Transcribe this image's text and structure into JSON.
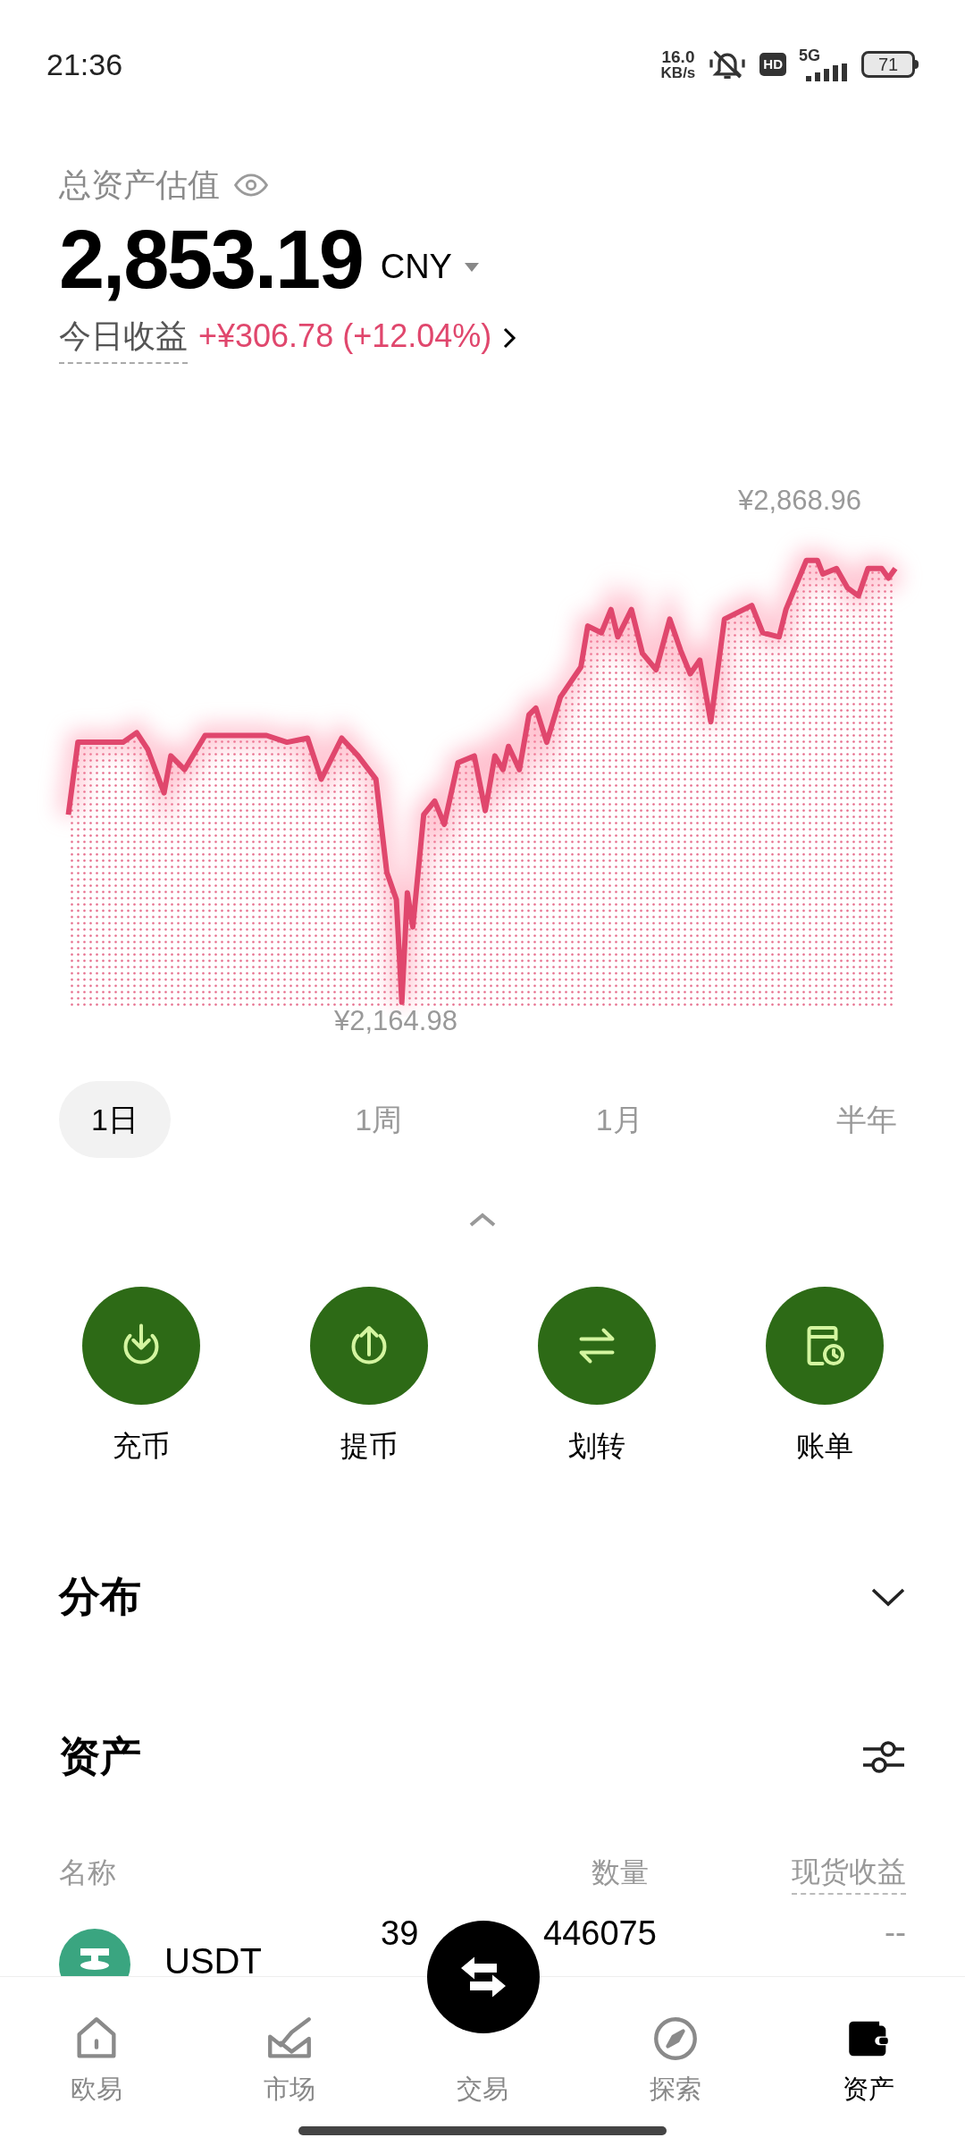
{
  "status_bar": {
    "time": "21:36",
    "speed_value": "16.0",
    "speed_unit": "KB/s",
    "hd": "HD",
    "network": "5G",
    "battery": "71"
  },
  "header": {
    "title": "总资产估值",
    "amount": "2,853.19",
    "currency": "CNY",
    "today_label": "今日收益",
    "today_value": "+¥306.78 (+12.04%)"
  },
  "chart": {
    "max_label": "¥2,868.96",
    "min_label": "¥2,164.98"
  },
  "periods": [
    {
      "label": "1日",
      "selected": true
    },
    {
      "label": "1周",
      "selected": false
    },
    {
      "label": "1月",
      "selected": false
    },
    {
      "label": "半年",
      "selected": false
    }
  ],
  "actions": [
    {
      "label": "充币",
      "kind": "deposit"
    },
    {
      "label": "提币",
      "kind": "withdraw"
    },
    {
      "label": "划转",
      "kind": "transfer"
    },
    {
      "label": "账单",
      "kind": "bill"
    }
  ],
  "distribution": {
    "title": "分布",
    "expanded": false
  },
  "assets": {
    "title": "资产",
    "columns": [
      "名称",
      "数量",
      "现货收益"
    ],
    "rows": [
      {
        "name": "USDT",
        "amount_start": "39",
        "amount_end": "446075",
        "profit": "--"
      }
    ]
  },
  "nav": [
    {
      "label": "欧易",
      "kind": "home",
      "selected": false
    },
    {
      "label": "市场",
      "kind": "market",
      "selected": false
    },
    {
      "label": "交易",
      "kind": "trade",
      "selected": false
    },
    {
      "label": "探索",
      "kind": "explore",
      "selected": false
    },
    {
      "label": "资产",
      "kind": "wallet",
      "selected": true
    }
  ]
}
